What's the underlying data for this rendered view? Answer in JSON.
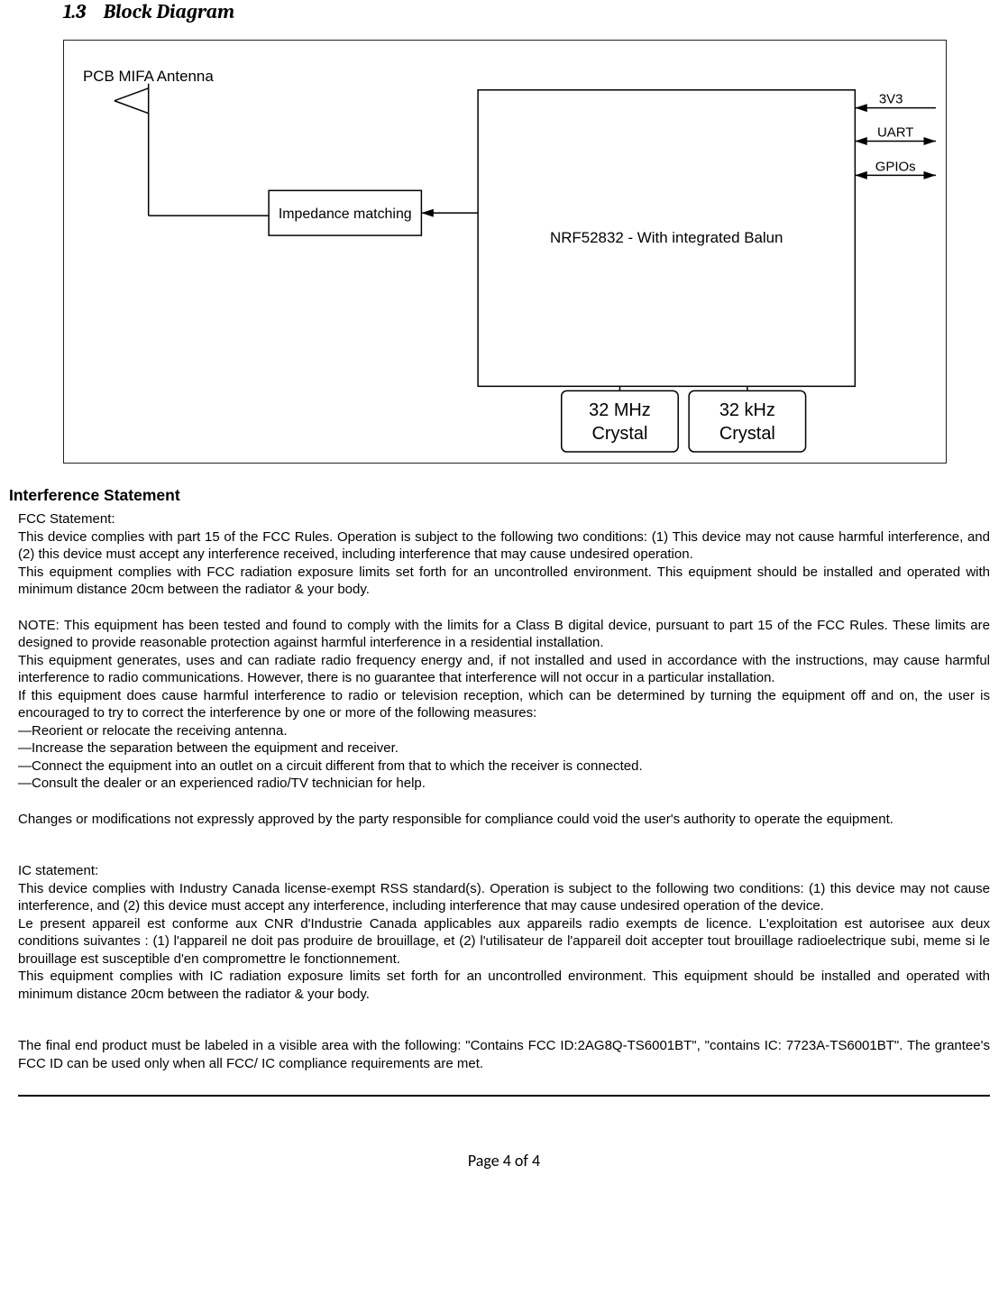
{
  "section": {
    "number": "1.3",
    "title": "Block Diagram"
  },
  "diagram": {
    "antenna": "PCB MIFA Antenna",
    "impedance": "Impedance matching",
    "chip": "NRF52832 - With integrated Balun",
    "crystal1_line1": "32 MHz",
    "crystal1_line2": "Crystal",
    "crystal2_line1": "32 kHz",
    "crystal2_line2": "Crystal",
    "lines": {
      "v3v3": "3V3",
      "uart": "UART",
      "gpios": "GPIOs"
    }
  },
  "interference_heading": "Interference Statement",
  "fcc": {
    "title": "FCC Statement:",
    "p1": "This device complies with part 15 of the FCC Rules. Operation is subject to the following two conditions: (1) This device may not cause harmful interference, and (2) this device must accept any interference received, including interference that may cause undesired operation.",
    "p2": "This equipment complies with FCC radiation exposure limits set forth for an uncontrolled environment. This equipment should be installed and operated with minimum distance 20cm between the radiator & your body.",
    "p3": "NOTE: This equipment has been tested and found to comply with the limits for a Class B digital device, pursuant to part 15 of the FCC Rules. These limits are designed to provide reasonable protection against harmful interference in a residential installation.",
    "p4": "This equipment generates, uses and can radiate radio frequency energy and, if not installed and used in accordance with the instructions, may cause harmful interference to radio communications. However, there is no guarantee that interference will not occur in a particular installation.",
    "p5": "If this equipment does cause harmful interference to radio or television reception, which can be determined by turning the equipment off and on, the user is encouraged to try to correct the interference by one or more of the following measures:",
    "m1": "—Reorient or relocate the receiving antenna.",
    "m2": "—Increase the separation between the equipment and receiver.",
    "m3": "—Connect the equipment into an outlet on a circuit different from that to which the receiver is connected.",
    "m4": "—Consult the dealer or an experienced radio/TV technician for help.",
    "p6": "Changes or modifications not expressly approved by the party responsible for compliance could void the user's authority to operate the equipment."
  },
  "ic": {
    "title": "IC statement:",
    "p1": "This device complies with Industry Canada license-exempt RSS standard(s). Operation is subject to the following two conditions: (1) this device may not cause interference, and (2) this device must accept any interference, including interference that may cause undesired operation of the device.",
    "p2": "Le present appareil est conforme aux CNR d'Industrie Canada applicables aux appareils radio exempts de licence. L'exploitation est autorisee aux deux conditions suivantes : (1) l'appareil ne doit pas produire de brouillage, et (2) l'utilisateur de l'appareil doit accepter tout brouillage radioelectrique subi, meme si le brouillage est susceptible d'en compromettre le fonctionnement.",
    "p3": "This equipment complies with IC radiation exposure limits set forth for an uncontrolled environment. This equipment should be installed and operated with minimum distance 20cm between the radiator & your body."
  },
  "label": "The final end product must be labeled in a visible area with the following: \"Contains FCC ID:2AG8Q-TS6001BT\", \"contains IC: 7723A-TS6001BT\". The grantee's FCC ID can be used only when all FCC/ IC compliance requirements are met.",
  "footer": "Page 4 of 4"
}
